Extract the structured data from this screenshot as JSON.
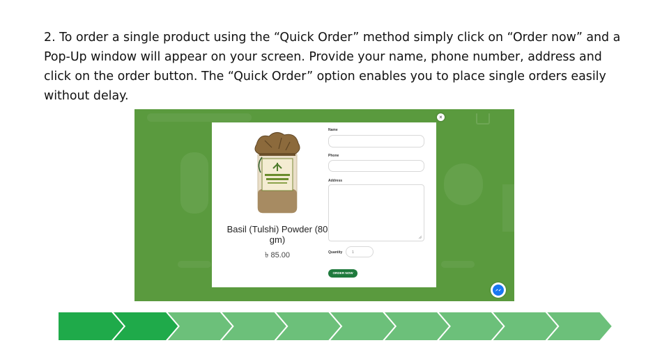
{
  "instruction": {
    "text": "2. To order a single product using the “Quick Order” method simply click on “Order now” and a Pop-Up window will appear on your screen. Provide your name, phone number, address and click on the order button. The “Quick Order” option enables you to place single orders easily without delay."
  },
  "modal": {
    "close_label": "×",
    "product": {
      "name": "Basil (Tulshi) Powder (80 gm)",
      "price": "৳ 85.00"
    },
    "form": {
      "name_label": "Name",
      "phone_label": "Phone",
      "address_label": "Address",
      "quantity_label": "Quantity",
      "quantity_value": "1",
      "order_button": "ORDER NOW"
    }
  },
  "colors": {
    "overlay_green": "#5a9a3e",
    "order_button": "#1f7a3d",
    "arrow_dark": "#1faa4a",
    "arrow_light": "#6cc07a"
  },
  "icons": [
    "close-icon",
    "messenger-icon",
    "cart-icon"
  ],
  "progress": {
    "steps_total": 10,
    "steps_complete": 2
  }
}
